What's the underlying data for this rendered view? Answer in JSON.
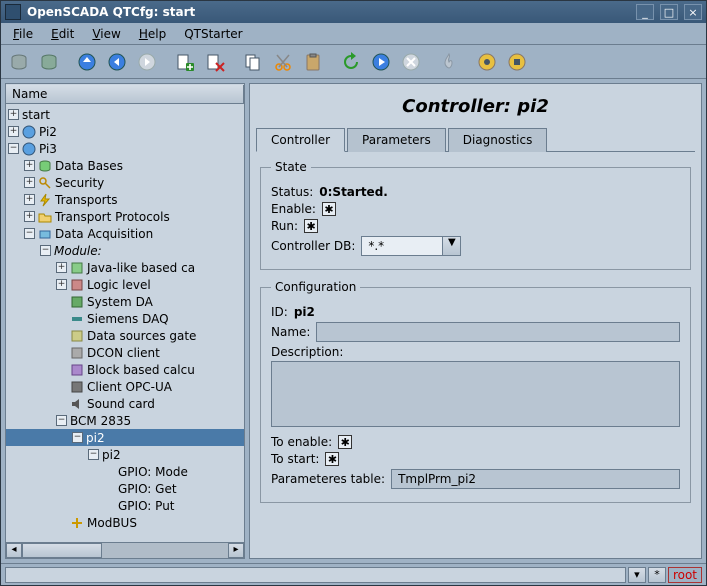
{
  "window": {
    "title": "OpenSCADA QTCfg: start"
  },
  "menu": {
    "file": "File",
    "edit": "Edit",
    "view": "View",
    "help": "Help",
    "qtstarter": "QTStarter"
  },
  "tree": {
    "header": "Name",
    "items": {
      "start": "start",
      "pi2root": "Pi2",
      "pi3root": "Pi3",
      "databases": "Data Bases",
      "security": "Security",
      "transports": "Transports",
      "transport_protocols": "Transport Protocols",
      "data_acquisition": "Data Acquisition",
      "module": "Module:",
      "javalike": "Java-like based ca",
      "logiclevel": "Logic level",
      "systemda": "System DA",
      "siemens": "Siemens DAQ",
      "datasources": "Data sources gate",
      "dcon": "DCON client",
      "blockcalc": "Block based calcu",
      "opcua": "Client OPC-UA",
      "soundcard": "Sound card",
      "bcm": "BCM 2835",
      "pi2ctrl": "pi2",
      "pi2sub": "pi2",
      "gpio_mode": "GPIO: Mode",
      "gpio_get": "GPIO: Get",
      "gpio_put": "GPIO: Put",
      "modbus": "ModBUS"
    }
  },
  "page": {
    "title": "Controller: pi2",
    "tabs": {
      "controller": "Controller",
      "parameters": "Parameters",
      "diagnostics": "Diagnostics"
    },
    "state": {
      "legend": "State",
      "status_label": "Status:",
      "status_value": "0:Started.",
      "enable_label": "Enable:",
      "run_label": "Run:",
      "controller_db_label": "Controller DB:",
      "controller_db_value": "*.*"
    },
    "config": {
      "legend": "Configuration",
      "id_label": "ID:",
      "id_value": "pi2",
      "name_label": "Name:",
      "name_value": "",
      "description_label": "Description:",
      "description_value": "",
      "to_enable_label": "To enable:",
      "to_start_label": "To start:",
      "param_table_label": "Parameteres table:",
      "param_table_value": "TmplPrm_pi2"
    }
  },
  "status": {
    "user": "root"
  }
}
